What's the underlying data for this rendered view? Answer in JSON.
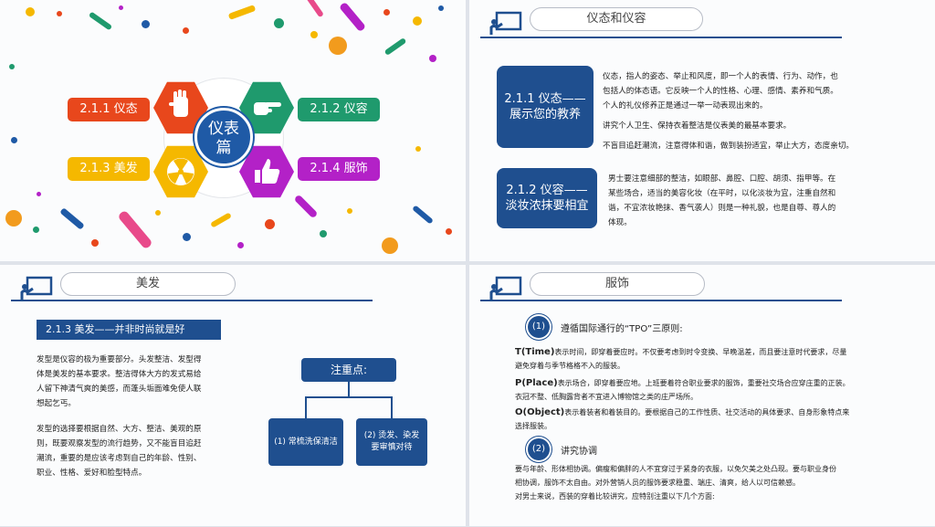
{
  "slide1": {
    "center_text_line1": "仪表",
    "center_text_line2": "篇",
    "tags": [
      {
        "label": "2.1.1 仪态",
        "color": "#e8471c"
      },
      {
        "label": "2.1.2 仪容",
        "color": "#1f9a6d"
      },
      {
        "label": "2.1.3 美发",
        "color": "#f5b800"
      },
      {
        "label": "2.1.4 服饰",
        "color": "#b321c7"
      }
    ],
    "icons": [
      {
        "name": "hand-stop-icon",
        "color": "#e8471c"
      },
      {
        "name": "hand-pointing-icon",
        "color": "#1f9a6d"
      },
      {
        "name": "radiation-icon",
        "color": "#f5b800"
      },
      {
        "name": "thumbs-up-icon",
        "color": "#b321c7"
      }
    ]
  },
  "slide2": {
    "title": "仪态和仪容",
    "box1": "2.1.1 仪态——\n展示您的教养",
    "box1_lines": [
      "2.1.1 仪态——",
      "展示您的教养"
    ],
    "text1": [
      "仪态，指人的姿态、举止和风度，即一个人的表情、行为、动作，也",
      "包括人的体态语。它反映一个人的性格、心理、感情、素养和气质。",
      "个人的礼仪修养正是通过一举一动表现出来的。",
      "讲究个人卫生、保持衣着整洁是仪表美的最基本要求。",
      "不盲目追赶潮流，注意得体和谐，做到装扮适宜，举止大方，态度亲切。"
    ],
    "box2_lines": [
      "2.1.2 仪容——",
      "淡妆浓抹要相宜"
    ],
    "text2": [
      "男士要注意细部的整洁，如眼部、鼻腔、口腔、胡须、指甲等。在",
      "某些场合，适当的美容化妆（在平时，以化淡妆为宜，注重自然和",
      "谐，不宜浓妆艳抹、香气袭人）则是一种礼貌，也是自尊、尊人的",
      "体现。"
    ]
  },
  "slide3": {
    "title": "美发",
    "subtitle": "2.1.3 美发——并非时尚就是好",
    "para1": [
      "发型是仪容的极为重要部分。头发整洁、发型得",
      "体是美发的基本要求。整洁得体大方的发式易给",
      "人留下神清气爽的美感，而蓬头垢面难免使人联",
      "想起乞丐。"
    ],
    "para2": [
      "发型的选择要根据自然、大方、整洁、美观的原",
      "则，既要观察发型的流行趋势，又不能盲目追赶",
      "潮流，重要的是应该考虑到自己的年龄、性别、",
      "职业、性格、爱好和脸型特点。"
    ],
    "diagram": {
      "root": "注重点:",
      "left": "(1) 常梳洗保清洁",
      "right_lines": [
        "(2) 烫发、染发",
        "要审慎对待"
      ]
    }
  },
  "slide4": {
    "title": "服饰",
    "n1": "(1)",
    "h1": "遵循国际通行的“TPO”三原则:",
    "t_label": "T(Time)",
    "t_text_lines": [
      "表示时间，即穿着要应时。不仅要考虑到时令变换、早晚温差，而且要注意时代要求，尽量",
      "避免穿着与季节格格不入的服装。"
    ],
    "p_label": "P(Place)",
    "p_text_lines": [
      "表示场合，即穿着要应地。上班要着符合职业要求的服饰，重要社交场合应穿庄重的正装。",
      "衣冠不整、低胸露背者不宜进入博物馆之类的庄严场所。"
    ],
    "o_label": "O(Object)",
    "o_text_lines": [
      "表示着装者和着装目的。要根据自己的工作性质、社交活动的具体要求、自身形象特点来",
      "选择服装。"
    ],
    "n2": "(2)",
    "h2": "讲究协调",
    "c_lines": [
      "要与年龄、形体相协调。偏瘦和偏胖的人不宜穿过于紧身的衣服，以免欠美之处凸现。要与职业身份",
      "相协调，服饰不太自由。对外营销人员的服饰要求稳重、端庄、清爽，给人以可信赖感。",
      "对男士来说，西装的穿着比较讲究，应特别注重以下几个方面:"
    ]
  }
}
